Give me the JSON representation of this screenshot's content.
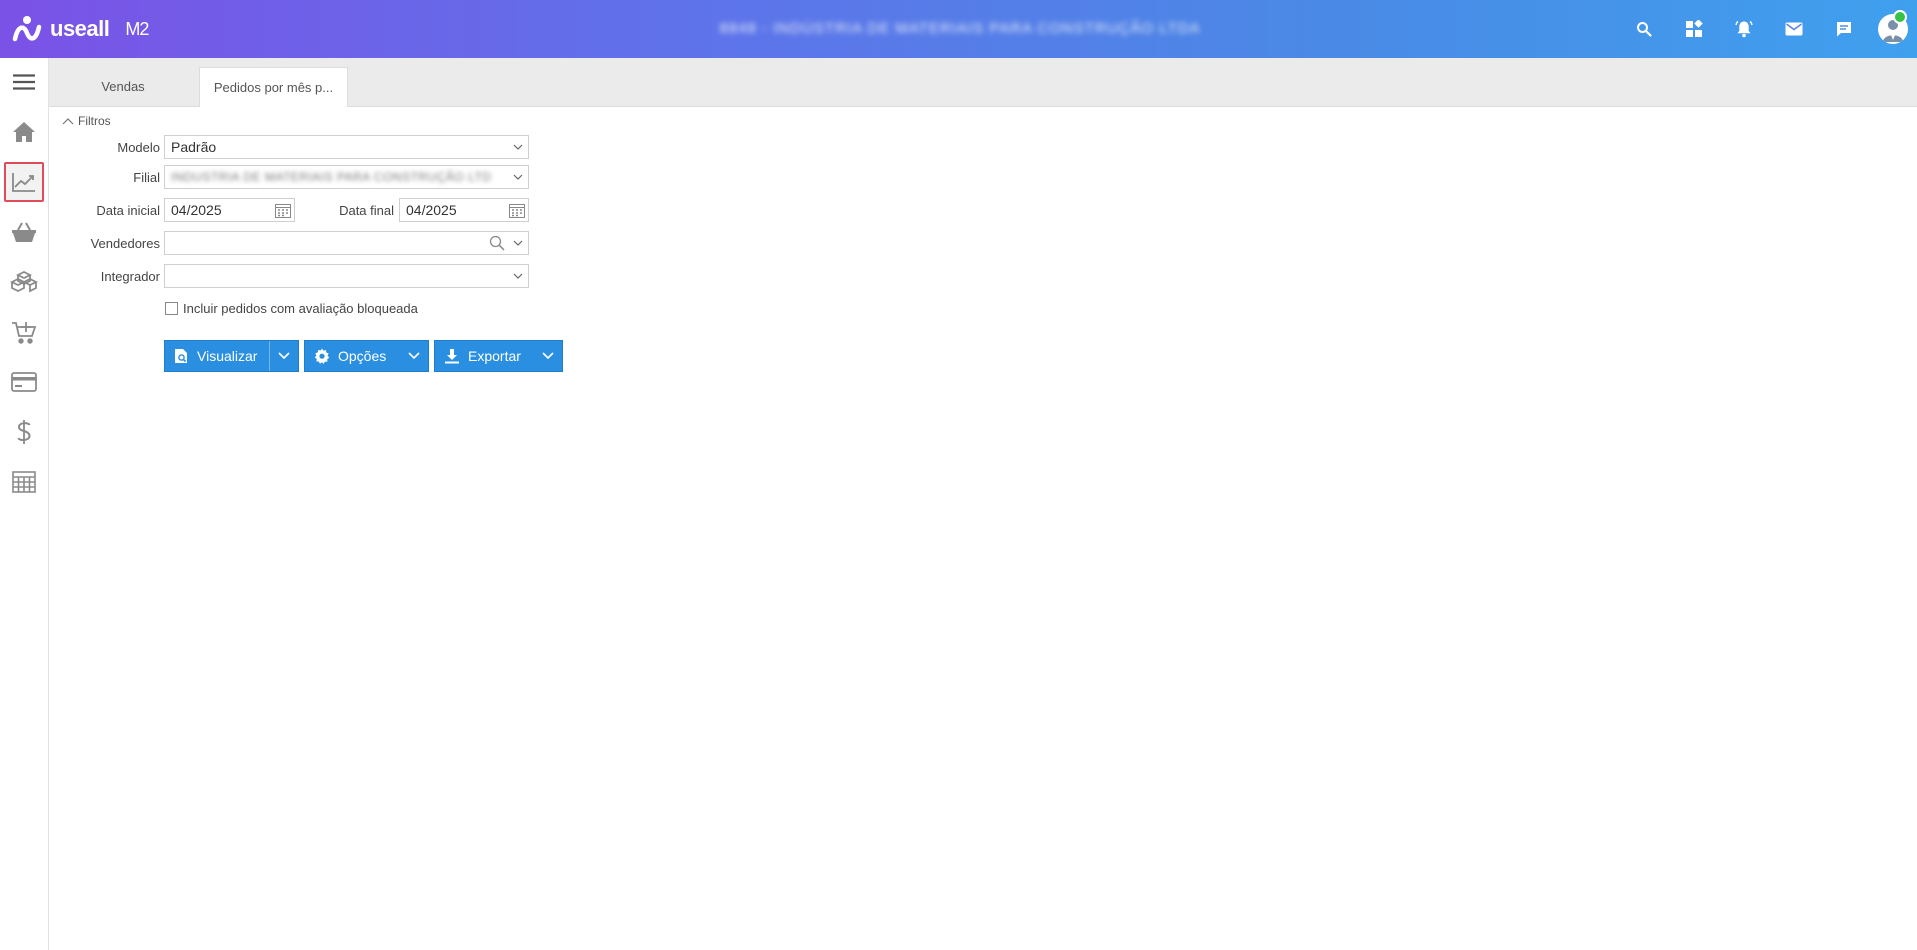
{
  "header": {
    "brand": "useall",
    "product": "M2",
    "company": "8848 - INDÚSTRIA DE MATERIAIS PARA CONSTRUÇÃO LTDA",
    "icons": [
      "search-icon",
      "apps-grid-icon",
      "bell-icon",
      "mail-icon",
      "chat-icon",
      "user-avatar"
    ]
  },
  "sidebar": {
    "items": [
      {
        "icon": "menu-icon"
      },
      {
        "icon": "home-icon"
      },
      {
        "icon": "chart-line-icon",
        "active": true
      },
      {
        "icon": "basket-icon"
      },
      {
        "icon": "boxes-icon"
      },
      {
        "icon": "cart-add-icon"
      },
      {
        "icon": "credit-card-icon"
      },
      {
        "icon": "dollar-icon"
      },
      {
        "icon": "calculator-icon"
      }
    ]
  },
  "tabs": [
    {
      "label": "Vendas"
    },
    {
      "label": "Pedidos por mês p...",
      "active": true
    }
  ],
  "filters": {
    "toggle_label": "Filtros",
    "modelo": {
      "label": "Modelo",
      "value": "Padrão"
    },
    "filial": {
      "label": "Filial",
      "value": "INDUSTRIA DE MATERIAIS PARA CONSTRUÇÃO LTD"
    },
    "data_inicial": {
      "label": "Data inicial",
      "value": "04/2025"
    },
    "data_final": {
      "label": "Data final",
      "value": "04/2025"
    },
    "vendedores": {
      "label": "Vendedores",
      "value": ""
    },
    "integrador": {
      "label": "Integrador",
      "value": ""
    },
    "checkbox": {
      "label": "Incluir pedidos com avaliação bloqueada",
      "checked": false
    }
  },
  "actions": {
    "visualizar": "Visualizar",
    "opcoes": "Opções",
    "exportar": "Exportar"
  },
  "colors": {
    "header_gradient": [
      "#7b52e6",
      "#3fa0ee"
    ],
    "button": "#2a8fe0",
    "active_border": "#e04b5a"
  }
}
